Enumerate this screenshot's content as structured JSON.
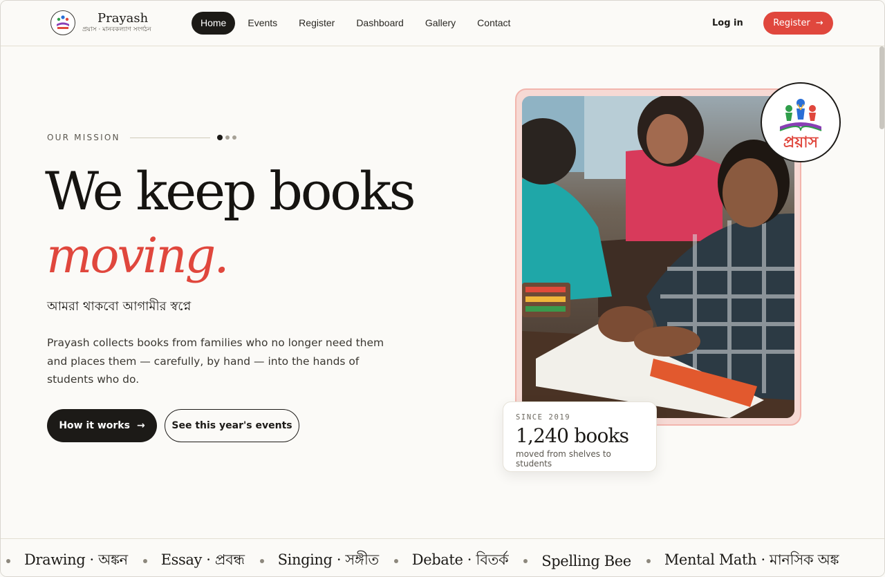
{
  "nav": {
    "brand_name": "Prayash",
    "brand_sub": "প্রয়াস · মানবকল্যাণ সংগঠন",
    "links": [
      "Home",
      "Events",
      "Register",
      "Dashboard",
      "Gallery",
      "Contact"
    ],
    "active": "Home",
    "login_label": "Log in",
    "register_label": "Register"
  },
  "hero": {
    "eyebrow": "OUR MISSION",
    "headline_1": "We keep books",
    "headline_2": "moving.",
    "bengali_tagline": "আমরা থাকবো আগামীর স্বপ্নে",
    "description": "Prayash collects books from families who no longer need them and places them — carefully, by hand — into the hands of students who do.",
    "primary_button": "How it works",
    "secondary_button": "See this year's events"
  },
  "stat": {
    "since": "SINCE 2019",
    "number": "1,240 books",
    "caption": "moved from shelves to students"
  },
  "badge_logo_text": "প্রয়াস",
  "marquee": [
    "Drawing · অঙ্কন",
    "Essay · প্রবন্ধ",
    "Singing · সঙ্গীত",
    "Debate · বিতর্ক",
    "Spelling Bee",
    "Mental Math · মানসিক অঙ্ক"
  ],
  "colors": {
    "accent": "#e0473d",
    "dark": "#1c1a17",
    "background": "#fbfaf7"
  }
}
